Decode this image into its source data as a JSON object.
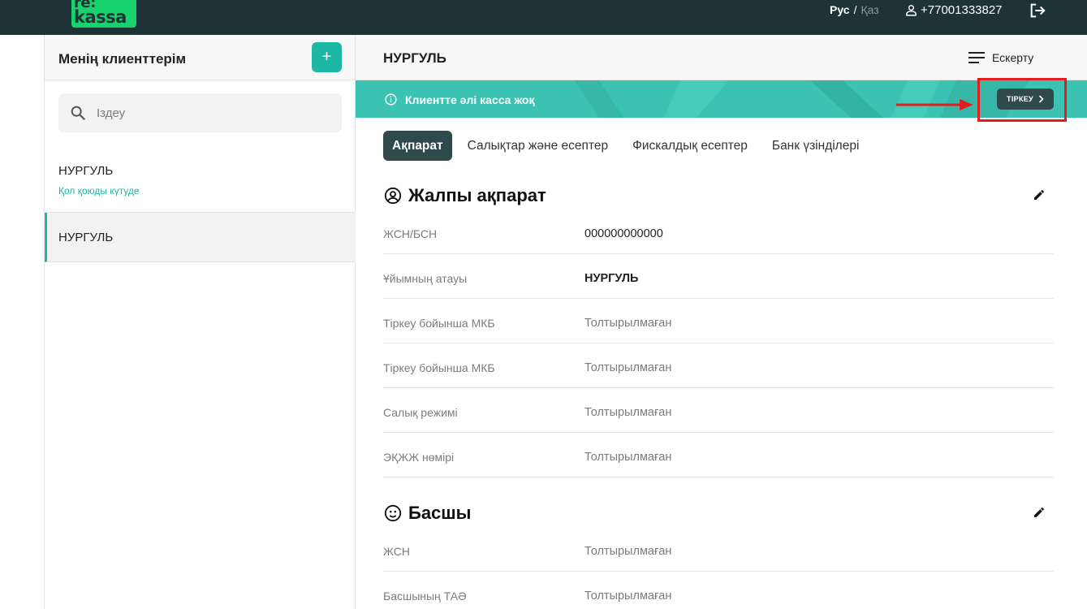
{
  "header": {
    "logo_line1": "re:",
    "logo_line2": "kassa",
    "lang_active": "Рус",
    "lang_sep": "/",
    "lang_inactive": "Қаз",
    "phone": "+77001333827",
    "icons": {
      "user": "user-icon",
      "logout": "logout-icon"
    }
  },
  "sidebar": {
    "title": "Менің клиенттерім",
    "add_label": "+",
    "search_placeholder": "Іздеу",
    "clients": [
      {
        "name": "НУРГУЛЬ",
        "status": "Қол қоюды күтуде"
      },
      {
        "name": "НУРГУЛЬ"
      }
    ]
  },
  "main": {
    "client_name": "НУРГУЛЬ",
    "notify_label": "Ескерту",
    "banner": {
      "message": "Клиентте әлі касса жоқ",
      "button_label": "ТІРКЕУ",
      "color": "#3cc2b2"
    },
    "tabs": [
      {
        "label": "Ақпарат",
        "active": true
      },
      {
        "label": "Салықтар және есептер"
      },
      {
        "label": "Фискалдық есептер"
      },
      {
        "label": "Банк үзінділері"
      }
    ],
    "general": {
      "title": "Жалпы ақпарат",
      "rows": [
        {
          "label": "ЖСН/БСН",
          "value": "000000000000"
        },
        {
          "label": "Ұйымның атауы",
          "value": "НУРГУЛЬ"
        },
        {
          "label": "Тіркеу бойынша МКБ",
          "value": "Толтырылмаған"
        },
        {
          "label": "Тіркеу бойынша МКБ",
          "value": "Толтырылмаған"
        },
        {
          "label": "Салық режимі",
          "value": "Толтырылмаған"
        },
        {
          "label": "ЭҚЖЖ нөмірі",
          "value": "Толтырылмаған"
        }
      ]
    },
    "head": {
      "title": "Басшы",
      "rows": [
        {
          "label": "ЖСН",
          "value": "Толтырылмаған"
        },
        {
          "label": "Басшының ТАӘ",
          "value": "Толтырылмаған"
        }
      ]
    }
  },
  "colors": {
    "topbar": "#1d3336",
    "accent": "#1db8a3",
    "dark_button": "#2f4a4d",
    "annotation": "#e11d1d"
  }
}
